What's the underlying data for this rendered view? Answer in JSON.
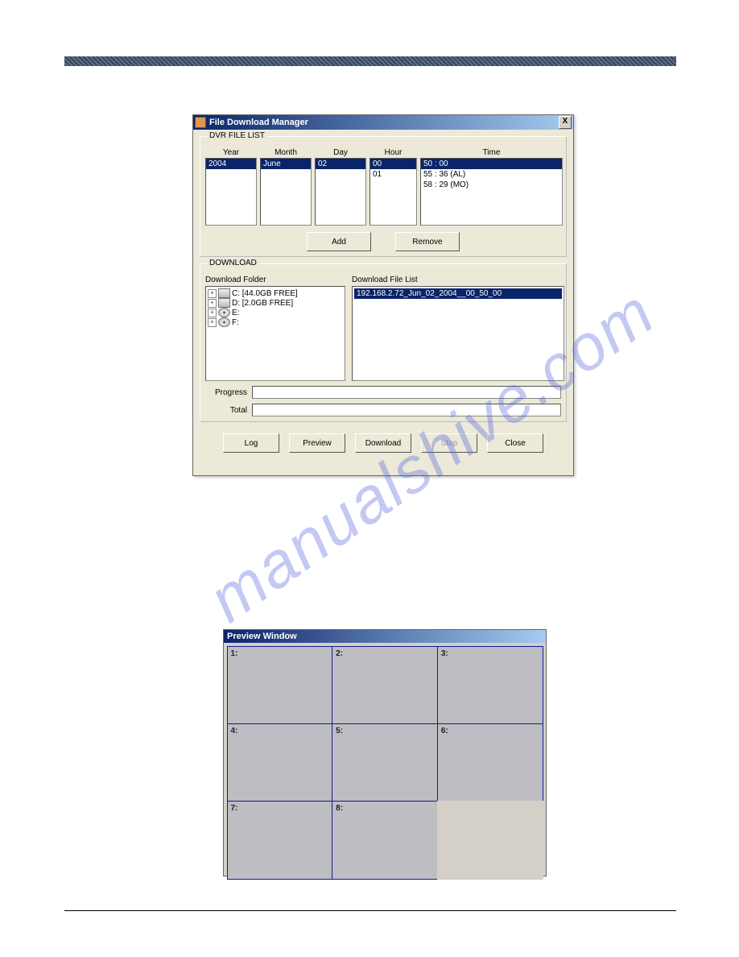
{
  "fdm": {
    "title": "File Download Manager",
    "close_x": "X",
    "group_dvr": "DVR FILE LIST",
    "cols": {
      "year": "Year",
      "month": "Month",
      "day": "Day",
      "hour": "Hour",
      "time": "Time"
    },
    "year_items": [
      "2004"
    ],
    "month_items": [
      "June"
    ],
    "day_items": [
      "02"
    ],
    "hour_items": [
      "00",
      "01"
    ],
    "time_items": [
      "50 : 00",
      "55 : 36 (AL)",
      "58 : 29 (MO)"
    ],
    "btn_add": "Add",
    "btn_remove": "Remove",
    "group_download": "DOWNLOAD",
    "dl_folder_label": "Download Folder",
    "dl_filelist_label": "Download File List",
    "drives": [
      {
        "name": "C: [44.0GB FREE]",
        "type": "hdd"
      },
      {
        "name": "D: [2.0GB FREE]",
        "type": "hdd"
      },
      {
        "name": "E:",
        "type": "cd"
      },
      {
        "name": "F:",
        "type": "cd"
      }
    ],
    "dl_file": "192.168.2.72_Jun_02_2004__00_50_00",
    "progress_label": "Progress",
    "total_label": "Total",
    "btn_log": "Log",
    "btn_preview": "Preview",
    "btn_download": "Download",
    "btn_stop": "Stop",
    "btn_close": "Close"
  },
  "preview": {
    "title": "Preview Window",
    "cells": [
      "1:",
      "2:",
      "3:",
      "4:",
      "5:",
      "6:",
      "7:",
      "8:",
      ""
    ]
  },
  "watermark": "manualshive.com"
}
